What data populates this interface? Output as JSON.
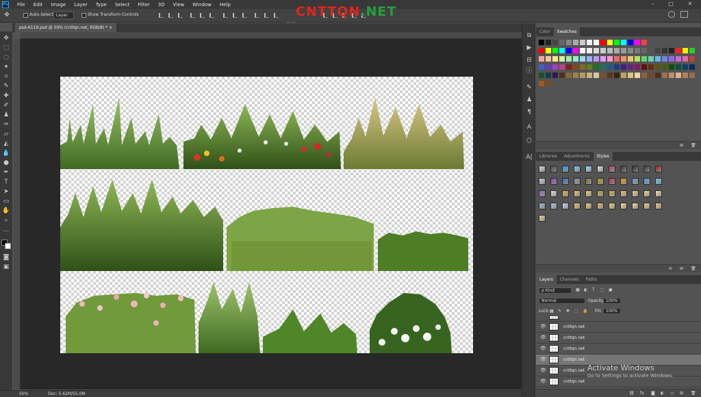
{
  "menubar": {
    "logo": "Ps",
    "items": [
      "File",
      "Edit",
      "Image",
      "Layer",
      "Type",
      "Select",
      "Filter",
      "3D",
      "View",
      "Window",
      "Help"
    ]
  },
  "options": {
    "auto_select": "Auto-Select:",
    "layer_dropdown": "Layer",
    "transform": "Show Transform Controls",
    "mode3d": "3D Mo"
  },
  "watermark": {
    "prefix": "CNTTQN",
    "suffix": ".NET"
  },
  "document": {
    "tab": "psd-6119.psd @ 50% (cnttqn.net, RGB/8) *",
    "close": "×"
  },
  "status": {
    "zoom": "50%",
    "doc": "Doc: 5.62M/55.0M"
  },
  "color_panel": {
    "tabs": [
      "Color",
      "Swatches"
    ],
    "active": 1
  },
  "styles_panel": {
    "tabs": [
      "Libraries",
      "Adjustments",
      "Styles"
    ],
    "active": 2
  },
  "layers_panel": {
    "tabs": [
      "Layers",
      "Channels",
      "Paths"
    ],
    "active": 0,
    "kind": "ρ Kind",
    "blend": "Normal",
    "opacity_label": "Opacity:",
    "opacity": "100%",
    "lock_label": "Lock:",
    "fill_label": "Fill:",
    "fill": "100%",
    "layers": [
      {
        "name": "cnttqn.net"
      },
      {
        "name": "cnttqn.net"
      },
      {
        "name": "cnttqn.net"
      },
      {
        "name": "cnttqn.net",
        "selected": true
      },
      {
        "name": "cnttqn.net"
      },
      {
        "name": "cnttqn.net"
      }
    ]
  },
  "activation": {
    "title": "Activate Windows",
    "subtitle": "Go to Settings to activate Windows."
  },
  "colors": {
    "accent": "#31a8ff",
    "watermark_red": "#e0251c",
    "watermark_green": "#22a03a"
  }
}
